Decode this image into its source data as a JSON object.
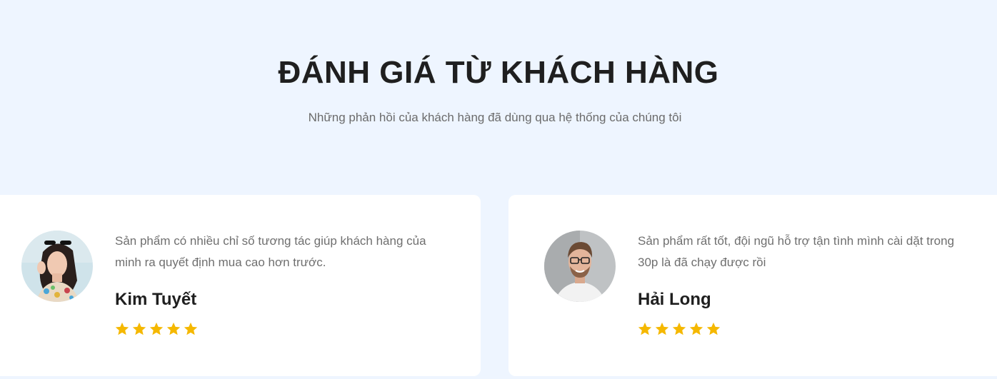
{
  "header": {
    "title": "ĐÁNH GIÁ TỪ KHÁCH HÀNG",
    "subtitle": "Những phản hồi của khách hàng đã dùng qua hệ thống của chúng tôi"
  },
  "testimonials": [
    {
      "quote": "Sản phẩm có nhiều chỉ số tương tác giúp khách hàng của minh ra quyết định mua cao hơn trước.",
      "name": "Kim Tuyết",
      "rating": 5,
      "rating_max": 5
    },
    {
      "quote": "Sản phẩm rất tốt, đội ngũ hỗ trợ tận tình mình cài dặt trong 30p là đã chạy được rồi",
      "name": "Hải Long",
      "rating": 5,
      "rating_max": 5
    }
  ],
  "colors": {
    "background": "#eef5ff",
    "card": "#ffffff",
    "star": "#f5b800",
    "title": "#1f1f1f",
    "text": "#6f6f6f"
  },
  "icons": {
    "star": "star-icon"
  }
}
